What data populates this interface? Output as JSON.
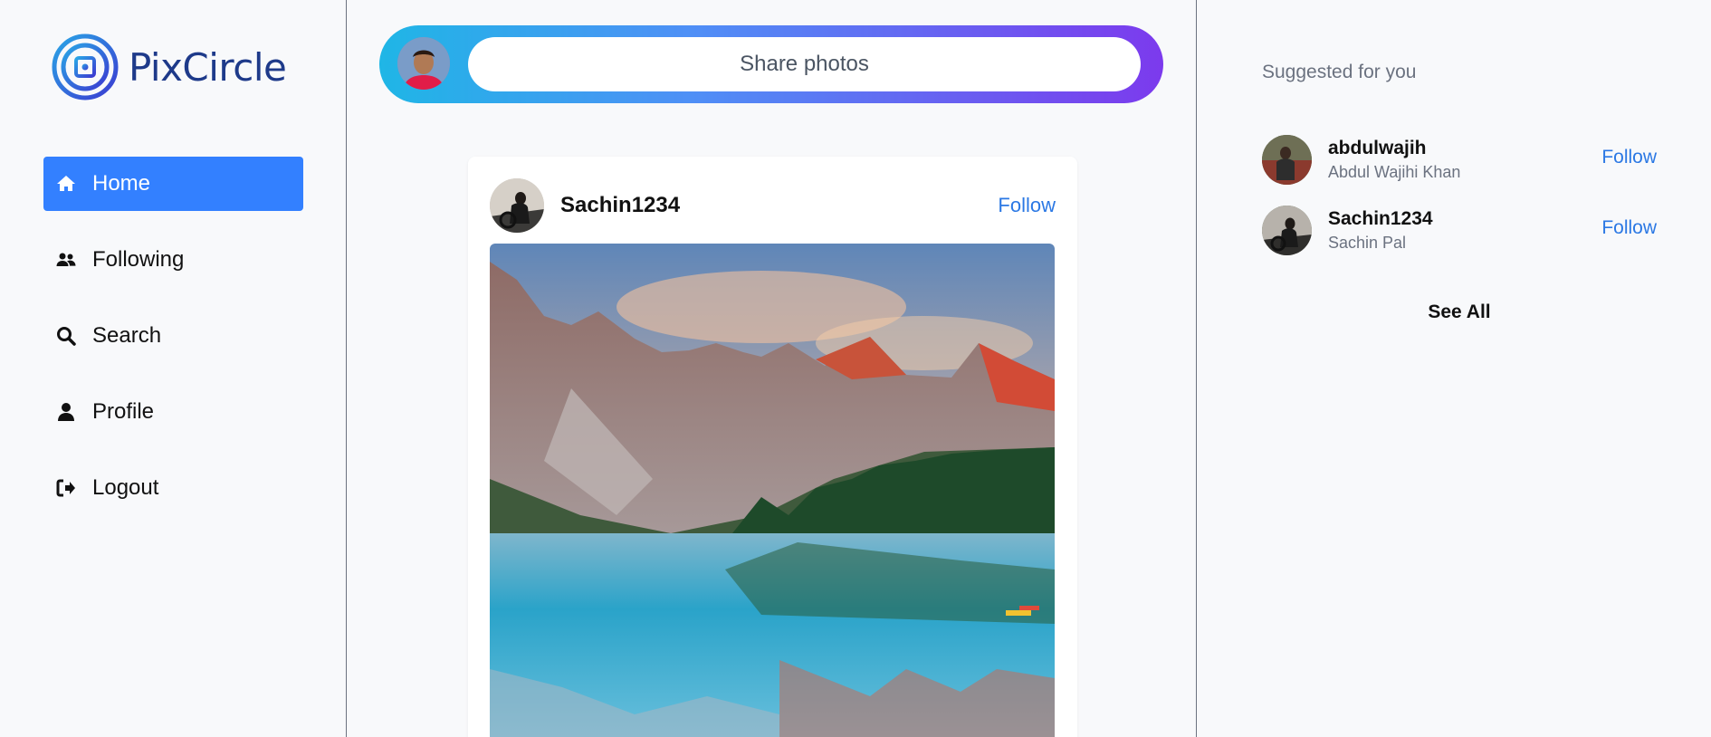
{
  "app": {
    "name": "PixCircle"
  },
  "sidebar": {
    "items": [
      {
        "label": "Home",
        "icon": "home-icon",
        "active": true
      },
      {
        "label": "Following",
        "icon": "users-icon",
        "active": false
      },
      {
        "label": "Search",
        "icon": "search-icon",
        "active": false
      },
      {
        "label": "Profile",
        "icon": "user-icon",
        "active": false
      },
      {
        "label": "Logout",
        "icon": "logout-icon",
        "active": false
      }
    ]
  },
  "share": {
    "placeholder": "Share photos"
  },
  "post": {
    "username": "Sachin1234",
    "follow_label": "Follow"
  },
  "suggestions": {
    "title": "Suggested for you",
    "users": [
      {
        "username": "abdulwajih",
        "name": "Abdul Wajihi Khan",
        "follow_label": "Follow"
      },
      {
        "username": "Sachin1234",
        "name": "Sachin Pal",
        "follow_label": "Follow"
      }
    ],
    "see_all_label": "See All"
  },
  "colors": {
    "accent": "#3380ff",
    "link": "#2b78e4",
    "brand": "#1e3a8a"
  }
}
